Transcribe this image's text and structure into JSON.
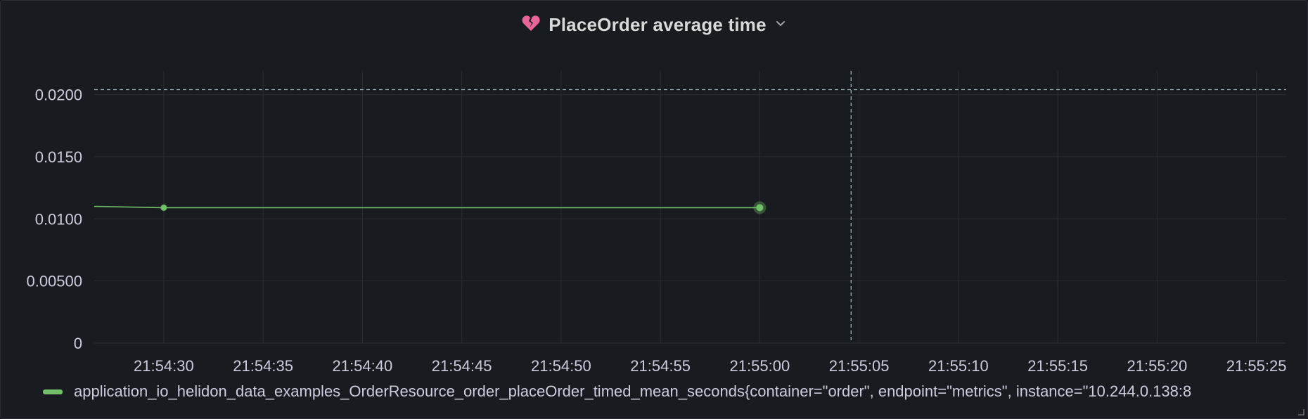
{
  "panel": {
    "title": "PlaceOrder average time",
    "status_icon": "broken-heart-icon",
    "menu_icon": "chevron-down-icon",
    "status_color": "#e8659a"
  },
  "chart_data": {
    "type": "line",
    "title": "PlaceOrder average time",
    "xlabel": "",
    "ylabel": "",
    "y_ticks": [
      "0",
      "0.00500",
      "0.0100",
      "0.0150",
      "0.0200"
    ],
    "y_tick_values": [
      0,
      0.005,
      0.01,
      0.015,
      0.02
    ],
    "ylim": [
      0,
      0.0219
    ],
    "x_ticks": [
      "21:54:30",
      "21:54:35",
      "21:54:40",
      "21:54:45",
      "21:54:50",
      "21:54:55",
      "21:55:00",
      "21:55:05",
      "21:55:10",
      "21:55:15",
      "21:55:20",
      "21:55:25"
    ],
    "x_tick_seconds": [
      30,
      35,
      40,
      45,
      50,
      55,
      60,
      65,
      70,
      75,
      80,
      85
    ],
    "xlim_seconds": [
      26.5,
      86.5
    ],
    "x_unit": "seconds after 21:54:00",
    "threshold": 0.0204,
    "cursor_x_seconds": 64.6,
    "grid": true,
    "legend_position": "bottom",
    "series": [
      {
        "name": "application_io_helidon_data_examples_OrderResource_order_placeOrder_timed_mean_seconds{container=\"order\", endpoint=\"metrics\", instance=\"10.244.0.138:8",
        "color": "#73bf69",
        "x": [
          26.5,
          30,
          60
        ],
        "y": [
          0.011,
          0.0109,
          0.0109
        ]
      }
    ]
  }
}
